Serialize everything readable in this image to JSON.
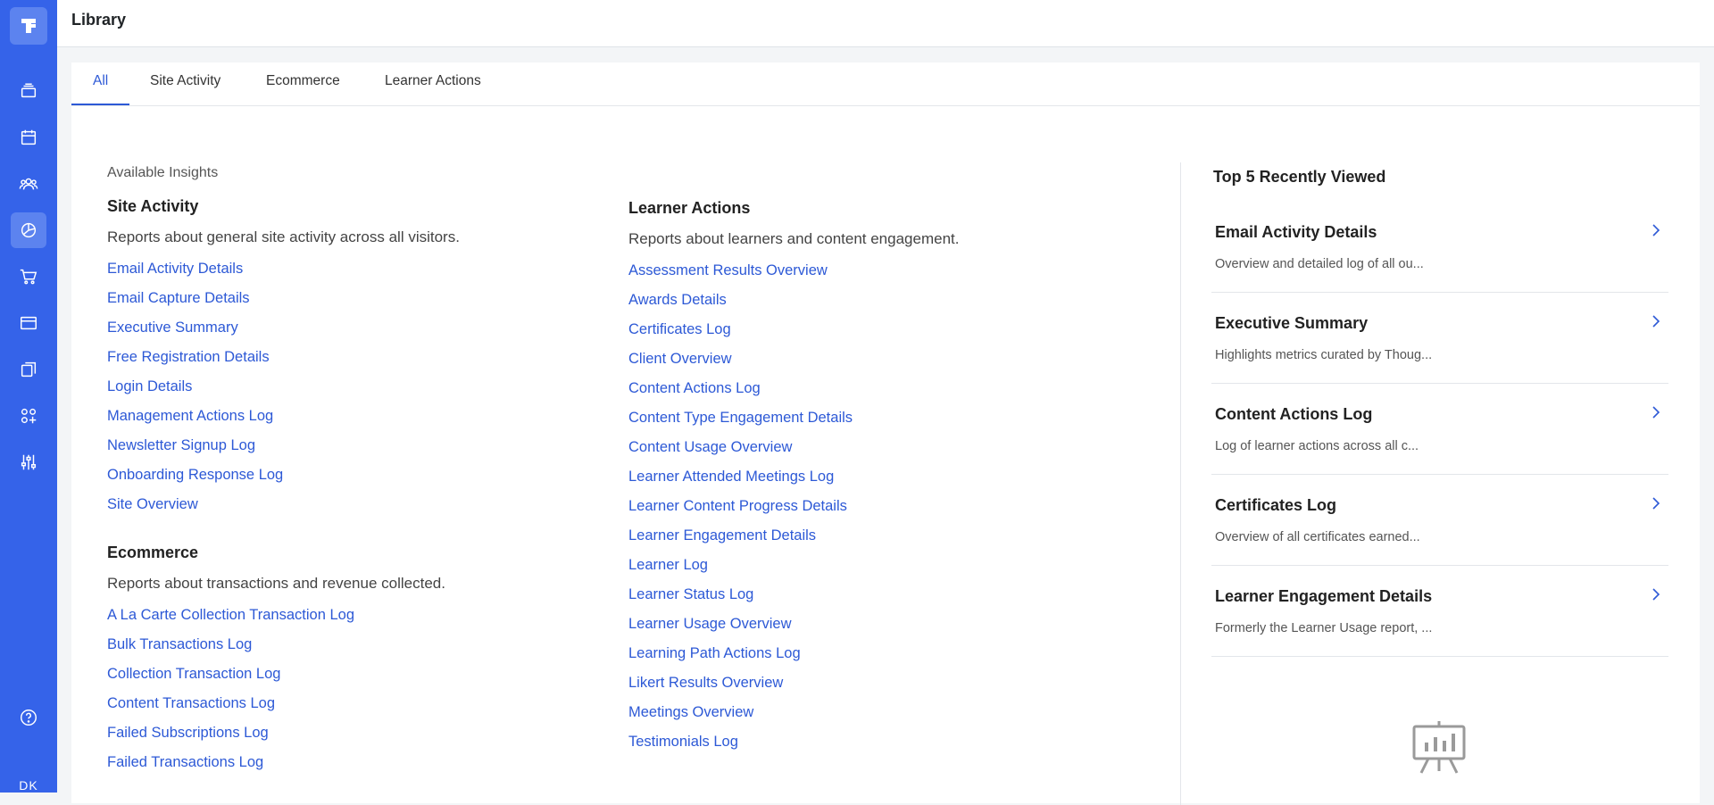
{
  "app": {
    "avatar_initials": "DK",
    "sidebar_icons": [
      "logo-icon",
      "stack-icon",
      "calendar-icon",
      "people-icon",
      "insights-icon",
      "cart-icon",
      "card-icon",
      "pages-icon",
      "apps-icon",
      "sliders-icon",
      "help-icon"
    ],
    "accent_color": "#3563e9",
    "link_color": "#2d59d6"
  },
  "header": {
    "title": "Library"
  },
  "tabs": [
    {
      "label": "All",
      "active": true
    },
    {
      "label": "Site Activity",
      "active": false
    },
    {
      "label": "Ecommerce",
      "active": false
    },
    {
      "label": "Learner Actions",
      "active": false
    }
  ],
  "insights": {
    "available_label": "Available Insights",
    "site_activity": {
      "title": "Site Activity",
      "description": "Reports about general site activity across all visitors.",
      "links": [
        "Email Activity Details",
        "Email Capture Details",
        "Executive Summary",
        "Free Registration Details",
        "Login Details",
        "Management Actions Log",
        "Newsletter Signup Log",
        "Onboarding Response Log",
        "Site Overview"
      ]
    },
    "ecommerce": {
      "title": "Ecommerce",
      "description": "Reports about transactions and revenue collected.",
      "links": [
        "A La Carte Collection Transaction Log",
        "Bulk Transactions Log",
        "Collection Transaction Log",
        "Content Transactions Log",
        "Failed Subscriptions Log",
        "Failed Transactions Log"
      ]
    },
    "learner_actions": {
      "title": "Learner Actions",
      "description": "Reports about learners and content engagement.",
      "links": [
        "Assessment Results Overview",
        "Awards Details",
        "Certificates Log",
        "Client Overview",
        "Content Actions Log",
        "Content Type Engagement Details",
        "Content Usage Overview",
        "Learner Attended Meetings Log",
        "Learner Content Progress Details",
        "Learner Engagement Details",
        "Learner Log",
        "Learner Status Log",
        "Learner Usage Overview",
        "Learning Path Actions Log",
        "Likert Results Overview",
        "Meetings Overview",
        "Testimonials Log"
      ]
    }
  },
  "recent": {
    "title": "Top 5 Recently Viewed",
    "items": [
      {
        "name": "Email Activity Details",
        "description": "Overview and detailed log of all ou..."
      },
      {
        "name": "Executive Summary",
        "description": "Highlights metrics curated by Thoug..."
      },
      {
        "name": "Content Actions Log",
        "description": "Log of learner actions across all c..."
      },
      {
        "name": "Certificates Log",
        "description": "Overview of all certificates earned..."
      },
      {
        "name": "Learner Engagement Details",
        "description": "Formerly the Learner Usage report, ..."
      }
    ]
  }
}
